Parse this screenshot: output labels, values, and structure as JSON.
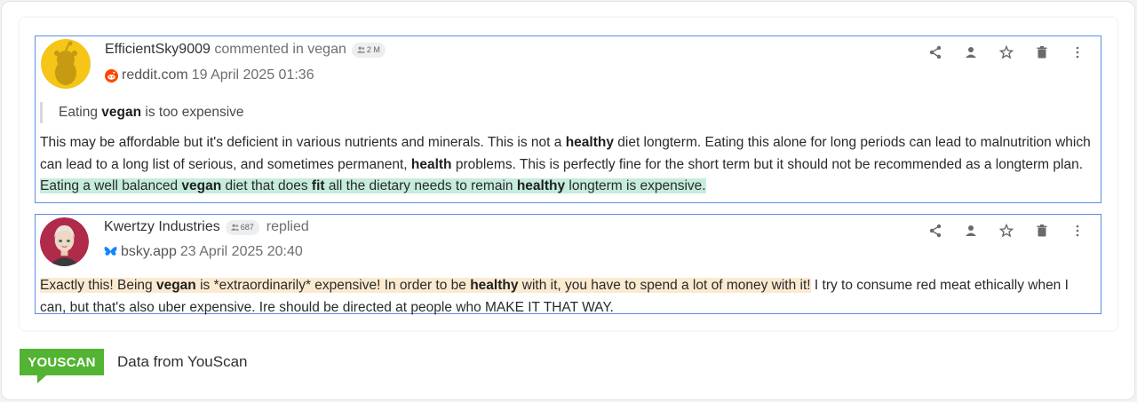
{
  "posts": [
    {
      "author": "EfficientSky9009",
      "action": "commented in vegan",
      "followers": "2 M",
      "source": "reddit.com",
      "date": "19 April 2025 01:36",
      "source_icon": "reddit-icon",
      "quote_pre": "Eating ",
      "quote_bold": "vegan",
      "quote_post": " is too expensive",
      "body": {
        "t1": "This may be affordable but it's deficient in various nutrients and minerals. This is not a ",
        "b1": "healthy",
        "t2": " diet longterm. Eating this alone for long periods can lead to malnutrition which can lead to a long list of serious, and sometimes permanent, ",
        "b2": "health",
        "t3": " problems. This is perfectly fine for the short term but it should not be recommended as a longterm plan. ",
        "h1": "Eating a well balanced ",
        "hb1": "vegan",
        "h2": " diet that does ",
        "hb2": "fit",
        "h3": " all the dietary needs to remain ",
        "hb3": "healthy",
        "h4": " longterm is expensive."
      }
    },
    {
      "author": "Kwertzy Industries",
      "action": "replied",
      "followers": "687",
      "source": "bsky.app",
      "date": "23 April 2025 20:40",
      "source_icon": "bluesky-icon",
      "body": {
        "h1": "Exactly this! Being ",
        "hb1": "vegan",
        "h2": " is *extraordinarily* expensive! In order to be ",
        "hb2": "healthy",
        "h3": " with it, you have to spend a lot of money with it!",
        "t1": " I try to consume red meat ethically when I can, but that's also uber expensive. Ire should be directed at people who MAKE IT THAT WAY."
      }
    }
  ],
  "actions": [
    "share-icon",
    "person-icon",
    "star-icon",
    "trash-icon",
    "more-icon"
  ],
  "footer": {
    "logo": "YOUSCAN",
    "text": "Data from YouScan"
  },
  "colors": {
    "accent_border": "#5b8ee6",
    "highlight_green": "#c6ecdd",
    "highlight_orange": "#fbead0",
    "brand_green": "#52b432",
    "reddit": "#ff4500",
    "bluesky": "#1185fe"
  }
}
